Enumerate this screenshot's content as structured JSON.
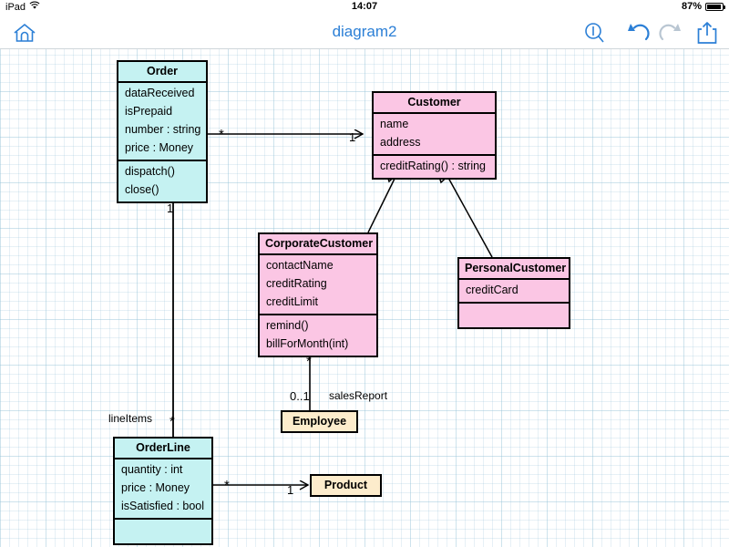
{
  "status_bar": {
    "carrier": "iPad",
    "wifi_icon": "wifi-icon",
    "time": "14:07",
    "battery_percent": "87%",
    "battery_icon": "battery-icon"
  },
  "toolbar": {
    "home_icon": "home-icon",
    "title": "diagram2",
    "search_icon": "search-icon",
    "undo_icon": "undo-icon",
    "redo_icon": "redo-icon",
    "share_icon": "share-icon",
    "title_color": "#2b7fd6",
    "active_icon_color": "#2b7fd6",
    "disabled_icon_color": "#b9c6d2"
  },
  "colors": {
    "class_cyan": "#c5f2f2",
    "class_pink": "#fbc6e4",
    "class_cream": "#fdeccc",
    "stroke": "#000000",
    "grid": "#96c3d7"
  },
  "diagram": {
    "classes": [
      {
        "id": "order",
        "name": "Order",
        "fill": "#c5f2f2",
        "attributes": [
          "dataReceived",
          "isPrepaid",
          "number : string",
          "price : Money"
        ],
        "operations": [
          "dispatch()",
          "close()"
        ]
      },
      {
        "id": "customer",
        "name": "Customer",
        "fill": "#fbc6e4",
        "attributes": [
          "name",
          "address"
        ],
        "operations": [
          "creditRating() : string"
        ]
      },
      {
        "id": "corporate_customer",
        "name": "CorporateCustomer",
        "fill": "#fbc6e4",
        "attributes": [
          "contactName",
          "creditRating",
          "creditLimit"
        ],
        "operations": [
          "remind()",
          "billForMonth(int)"
        ]
      },
      {
        "id": "personal_customer",
        "name": "PersonalCustomer",
        "fill": "#fbc6e4",
        "attributes": [
          "creditCard"
        ],
        "operations": []
      },
      {
        "id": "order_line",
        "name": "OrderLine",
        "fill": "#c5f2f2",
        "attributes": [
          "quantity : int",
          "price : Money",
          "isSatisfied : bool"
        ],
        "operations": []
      },
      {
        "id": "employee",
        "name": "Employee",
        "fill": "#fdeccc",
        "attributes": [],
        "operations": []
      },
      {
        "id": "product",
        "name": "Product",
        "fill": "#fdeccc",
        "attributes": [],
        "operations": []
      }
    ],
    "relationships": [
      {
        "id": "order-customer",
        "type": "association",
        "from": "Order",
        "to": "Customer",
        "source_multiplicity": "*",
        "target_multiplicity": "1",
        "role": ""
      },
      {
        "id": "order-orderline",
        "type": "association",
        "from": "Order",
        "to": "OrderLine",
        "source_multiplicity": "1",
        "target_multiplicity": "*",
        "role": "lineItems"
      },
      {
        "id": "corporate-customer-generalization",
        "type": "generalization",
        "from": "CorporateCustomer",
        "to": "Customer",
        "source_multiplicity": "",
        "target_multiplicity": "",
        "role": ""
      },
      {
        "id": "personal-customer-generalization",
        "type": "generalization",
        "from": "PersonalCustomer",
        "to": "Customer",
        "source_multiplicity": "",
        "target_multiplicity": "",
        "role": ""
      },
      {
        "id": "corporate-employee",
        "type": "association",
        "from": "CorporateCustomer",
        "to": "Employee",
        "source_multiplicity": "*",
        "target_multiplicity": "0..1",
        "role": "salesReport"
      },
      {
        "id": "orderline-product",
        "type": "association",
        "from": "OrderLine",
        "to": "Product",
        "source_multiplicity": "*",
        "target_multiplicity": "1",
        "role": ""
      }
    ],
    "edge_labels": {
      "order_customer_source": "*",
      "order_customer_target": "1",
      "order_orderline_source": "1",
      "order_orderline_target": "*",
      "order_orderline_role": "lineItems",
      "corporate_employee_source": "*",
      "corporate_employee_target": "0..1",
      "corporate_employee_role": "salesReport",
      "orderline_product_source": "*",
      "orderline_product_target": "1"
    }
  }
}
